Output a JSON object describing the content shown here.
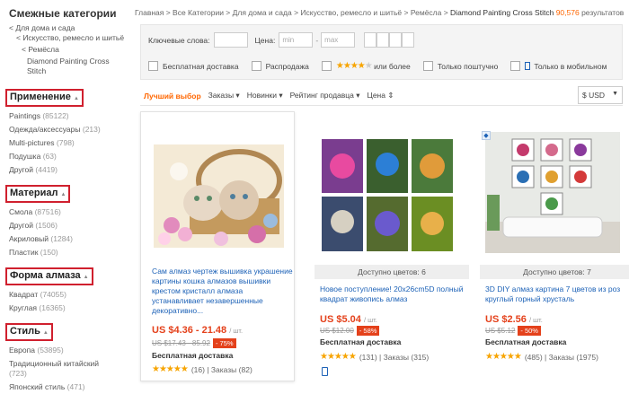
{
  "sidebar": {
    "title": "Смежные категории",
    "parent1": "< Для дома и сада",
    "parent2": "< Искусство, ремесло и шитьё",
    "parent3": "< Ремёсла",
    "current": "Diamond Painting Cross Stitch",
    "groups": [
      {
        "title": "Применение",
        "items": [
          {
            "label": "Paintings",
            "count": "(85122)"
          },
          {
            "label": "Одежда/аксессуары",
            "count": "(213)"
          },
          {
            "label": "Multi-pictures",
            "count": "(798)"
          },
          {
            "label": "Подушка",
            "count": "(63)"
          },
          {
            "label": "Другой",
            "count": "(4419)"
          }
        ]
      },
      {
        "title": "Материал",
        "items": [
          {
            "label": "Смола",
            "count": "(87516)"
          },
          {
            "label": "Другой",
            "count": "(1506)"
          },
          {
            "label": "Акриловый",
            "count": "(1284)"
          },
          {
            "label": "Пластик",
            "count": "(150)"
          }
        ]
      },
      {
        "title": "Форма алмаза",
        "items": [
          {
            "label": "Квадрат",
            "count": "(74055)"
          },
          {
            "label": "Круглая",
            "count": "(16365)"
          }
        ]
      },
      {
        "title": "Стиль",
        "items": [
          {
            "label": "Европа",
            "count": "(53895)"
          },
          {
            "label": "Традиционный китайский",
            "count": "(723)"
          },
          {
            "label": "Японский стиль",
            "count": "(471)"
          }
        ]
      }
    ]
  },
  "breadcrumb": {
    "items": [
      "Главная",
      "Все Категории",
      "Для дома и сада",
      "Искусство, ремесло и шитьё",
      "Ремёсла"
    ],
    "current": "Diamond Painting Cross Stitch",
    "count": "90,576",
    "results": "результатов"
  },
  "filter": {
    "keywords_label": "Ключевые слова:",
    "price_label": "Цена:",
    "min_placeholder": "min",
    "max_placeholder": "max",
    "dash": "-",
    "free_shipping": "Бесплатная доставка",
    "sale": "Распродажа",
    "or_more": "или более",
    "single_only": "Только поштучно",
    "mobile_only": "Только в мобильном"
  },
  "sort": {
    "best": "Лучший выбор",
    "orders": "Заказы",
    "new": "Новинки",
    "seller_rating": "Рейтинг продавца",
    "price": "Цена",
    "currency": "$ USD"
  },
  "products": [
    {
      "title": "Сам алмаз чертеж вышивка украшение картины кошка алмазов вышивки крестом кристалл алмаза устанавливает незавершенные декоративно...",
      "price": "US $4.36 - 21.48",
      "unit": "/ шт.",
      "old_price": "US $17.43 - 85.92",
      "discount": "- 75%",
      "shipping": "Бесплатная доставка",
      "rating_stars": 5,
      "reviews": "(16)",
      "orders": "Заказы (82)"
    },
    {
      "colors": "Доступно цветов: 6",
      "title": "Новое поступление! 20x26cm5D полный квадрат живопись алмаз",
      "price": "US $5.04",
      "unit": "/ шт.",
      "old_price": "US $12.00",
      "discount": "- 58%",
      "shipping": "Бесплатная доставка",
      "rating_stars": 5,
      "reviews": "(131)",
      "orders": "Заказы (315)"
    },
    {
      "colors": "Доступно цветов: 7",
      "title": "3D DIY алмаз картина 7 цветов из роз круглый горный хрусталь",
      "price": "US $2.56",
      "unit": "/ шт.",
      "old_price": "US $5.12",
      "discount": "- 50%",
      "shipping": "Бесплатная доставка",
      "rating_stars": 5,
      "reviews": "(485)",
      "orders": "Заказы (1975)"
    }
  ],
  "colors": {
    "accent": "#e4411b",
    "link": "#1d62b7",
    "highlight": "#d0202e",
    "star": "#f7a400"
  }
}
